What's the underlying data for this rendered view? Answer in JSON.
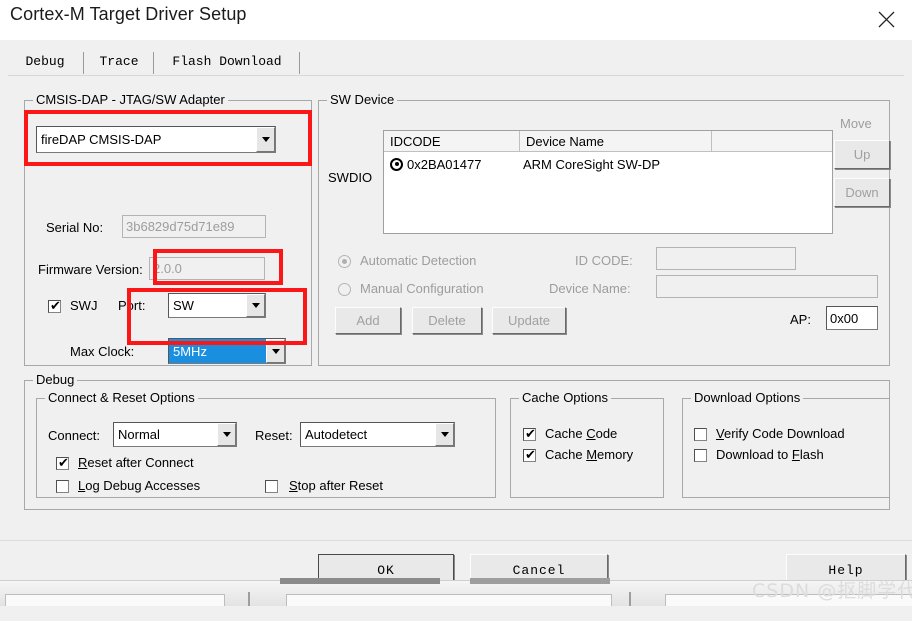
{
  "window": {
    "title": "Cortex-M Target Driver Setup",
    "close_icon": "close-icon"
  },
  "tabs": [
    {
      "label": "Debug",
      "active": true
    },
    {
      "label": "Trace",
      "active": false
    },
    {
      "label": "Flash Download",
      "active": false
    }
  ],
  "adapter_group": {
    "title": "CMSIS-DAP - JTAG/SW Adapter",
    "adapter_combo_value": "fireDAP CMSIS-DAP",
    "serial_label": "Serial No:",
    "serial_value": "3b6829d75d71e89",
    "firmware_label": "Firmware Version:",
    "firmware_value": "2.0.0",
    "swj_label": "SWJ",
    "swj_checked": true,
    "port_label": "Port:",
    "port_value": "SW",
    "max_clock_label": "Max Clock:",
    "max_clock_value": "5MHz"
  },
  "sw_device_group": {
    "title": "SW Device",
    "swdio_label": "SWDIO",
    "columns": [
      "IDCODE",
      "Device Name",
      ""
    ],
    "rows": [
      {
        "idcode": "0x2BA01477",
        "device_name": "ARM CoreSight SW-DP"
      }
    ],
    "move_label": "Move",
    "up_label": "Up",
    "down_label": "Down",
    "automatic_detection_label": "Automatic Detection",
    "manual_configuration_label": "Manual Configuration",
    "automatic_selected": true,
    "id_code_label": "ID CODE:",
    "id_code_value": "",
    "device_name_label": "Device Name:",
    "device_name_value": "",
    "add_label": "Add",
    "delete_label": "Delete",
    "update_label": "Update",
    "ap_label": "AP:",
    "ap_value": "0x00"
  },
  "debug_group": {
    "title": "Debug",
    "connect_reset": {
      "title": "Connect & Reset Options",
      "connect_label": "Connect:",
      "connect_value": "Normal",
      "reset_label": "Reset:",
      "reset_value": "Autodetect",
      "reset_after_connect": {
        "label_pre": "",
        "label_mnemonic": "R",
        "label_post": "eset after Connect",
        "checked": true
      },
      "log_debug_accesses": {
        "label_pre": "",
        "label_mnemonic": "L",
        "label_post": "og Debug Accesses",
        "checked": false
      },
      "stop_after_reset": {
        "label_pre": "",
        "label_mnemonic": "S",
        "label_post": "top after Reset",
        "checked": false
      }
    },
    "cache_options": {
      "title": "Cache Options",
      "cache_code": {
        "label_pre": "Cache ",
        "label_mnemonic": "C",
        "label_post": "ode",
        "checked": true
      },
      "cache_memory": {
        "label_pre": "Cache ",
        "label_mnemonic": "M",
        "label_post": "emory",
        "checked": true
      }
    },
    "download_options": {
      "title": "Download Options",
      "verify_code_download": {
        "label_pre": "",
        "label_mnemonic": "V",
        "label_post": "erify Code Download",
        "checked": false
      },
      "download_to_flash": {
        "label_pre": "Download to ",
        "label_mnemonic": "F",
        "label_post": "lash",
        "checked": false
      }
    }
  },
  "buttons": {
    "ok": "OK",
    "cancel": "Cancel",
    "help": "Help"
  },
  "annotations": {
    "highlight_color": "#fb1717",
    "boxes": [
      "adapter-combo",
      "swj-port-combo",
      "max-clock-combo"
    ]
  },
  "watermark": {
    "text": "CSDN @抠脚学代码"
  }
}
